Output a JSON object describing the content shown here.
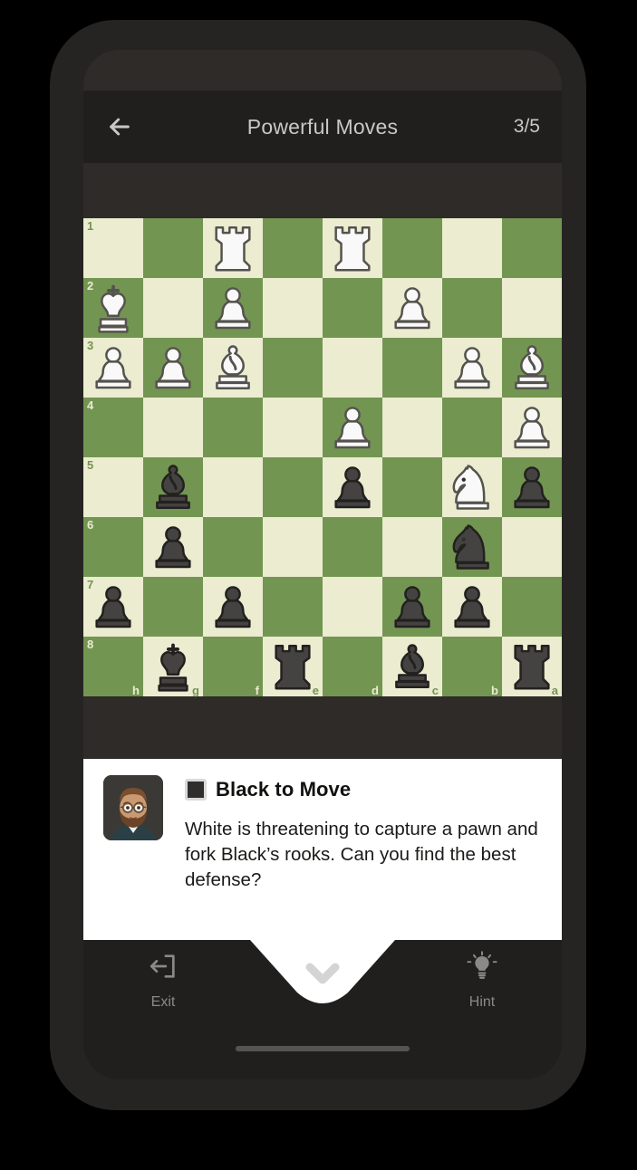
{
  "header": {
    "back_icon": "arrow-left-icon",
    "title": "Powerful Moves",
    "progress": "3/5"
  },
  "board": {
    "light_color": "#ebecd0",
    "dark_color": "#739552",
    "orientation": "black",
    "rank_labels": [
      "1",
      "2",
      "3",
      "4",
      "5",
      "6",
      "7",
      "8"
    ],
    "file_labels": [
      "h",
      "g",
      "f",
      "e",
      "d",
      "c",
      "b",
      "a"
    ],
    "rows": [
      [
        null,
        null,
        "wR",
        null,
        "wR",
        null,
        null,
        null
      ],
      [
        "wK",
        null,
        "wP",
        null,
        null,
        "wP",
        null,
        null
      ],
      [
        "wP",
        "wP",
        "wB",
        null,
        null,
        null,
        "wP",
        "wB"
      ],
      [
        null,
        null,
        null,
        null,
        "wP",
        null,
        null,
        "wP"
      ],
      [
        null,
        "bB",
        null,
        null,
        "bP",
        null,
        "wN",
        "bP"
      ],
      [
        null,
        "bP",
        null,
        null,
        null,
        null,
        "bN",
        null
      ],
      [
        "bP",
        null,
        "bP",
        null,
        null,
        "bP",
        "bP",
        null
      ],
      [
        null,
        "bK",
        null,
        "bR",
        null,
        "bB",
        null,
        "bR"
      ]
    ]
  },
  "card": {
    "avatar_icon": "user-avatar",
    "side_chip": "black-square-icon",
    "title": "Black to Move",
    "body": "White is threatening to capture a pawn and fork Black’s rooks. Can you find the best defense?"
  },
  "bottom_bar": {
    "exit": {
      "icon": "exit-icon",
      "label": "Exit"
    },
    "collapse": {
      "icon": "chevron-down-icon"
    },
    "hint": {
      "icon": "lightbulb-icon",
      "label": "Hint"
    }
  }
}
